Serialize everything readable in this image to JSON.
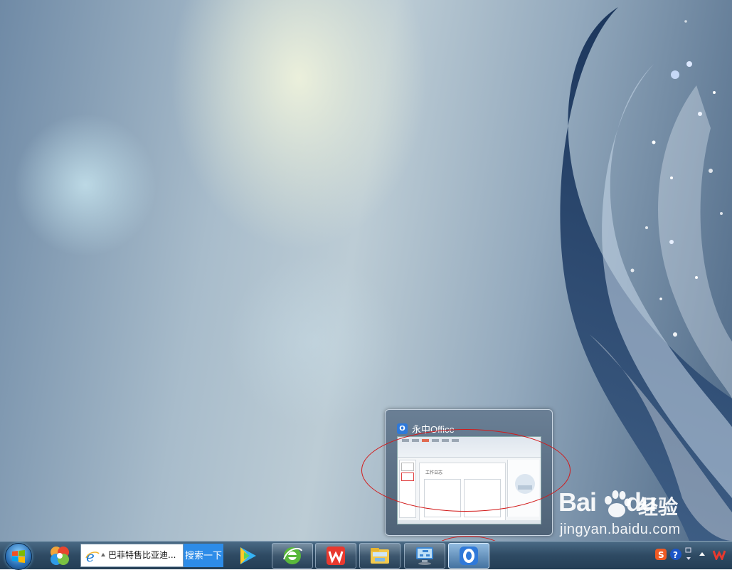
{
  "preview": {
    "app_title": "永中Office",
    "icon": "yozo-office-icon",
    "thumbnail_heading": "工作日志"
  },
  "taskbar": {
    "search": {
      "value": "巴菲特售比亚迪...",
      "button_label": "搜索一下",
      "engine_icon": "ie-icon"
    },
    "pinned": [
      {
        "name": "pinwheel-app-icon"
      },
      {
        "name": "video-player-icon"
      }
    ],
    "windows": [
      {
        "name": "ie-browser-icon",
        "active": false
      },
      {
        "name": "wps-office-icon",
        "active": false
      },
      {
        "name": "file-explorer-icon",
        "active": false
      },
      {
        "name": "network-monitor-icon",
        "active": false
      },
      {
        "name": "yozo-office-icon",
        "active": true
      }
    ],
    "tray": [
      {
        "name": "sogou-input-icon"
      },
      {
        "name": "help-icon"
      },
      {
        "name": "show-hidden-icons-icon"
      },
      {
        "name": "wps-tray-icon"
      }
    ]
  },
  "watermark": {
    "logo_text": "Bai",
    "logo_suffix": "du",
    "cn_text": "经验",
    "url": "jingyan.baidu.com"
  },
  "colors": {
    "annotation": "#d21a1a",
    "taskbar": "#2e4a63",
    "search_button": "#2d8ce8"
  }
}
